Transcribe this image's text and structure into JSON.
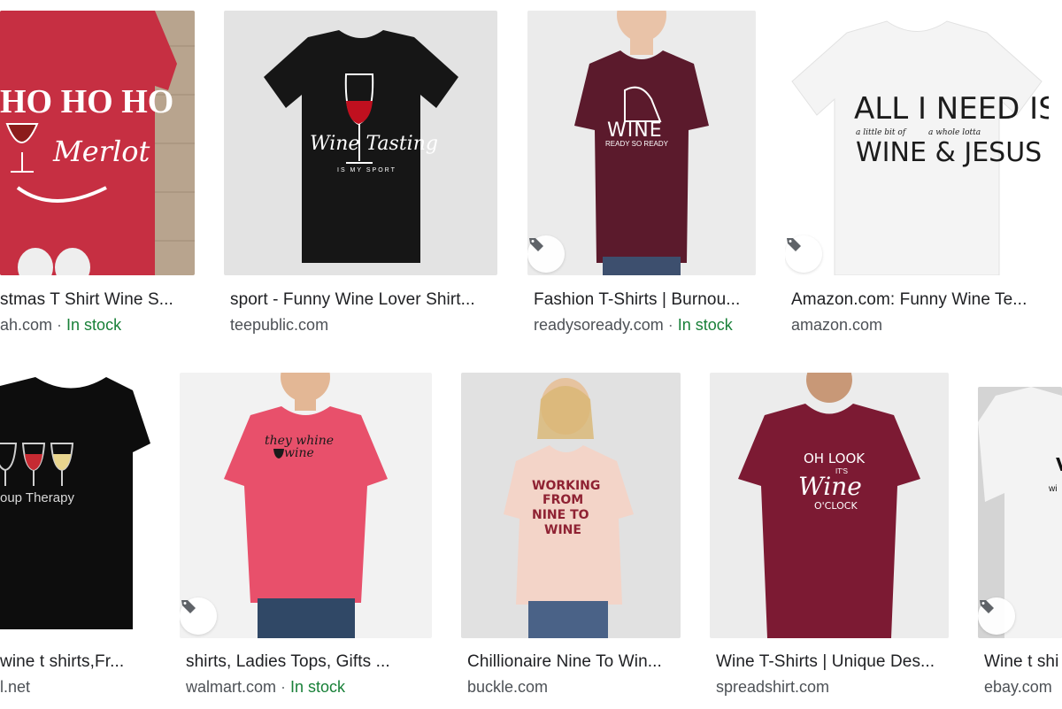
{
  "results": [
    {
      "title": "stmas T Shirt Wine S...",
      "source": "ah.com",
      "stock": "In stock",
      "shirt_color": "#c62f42",
      "bg": "#b6a28b",
      "print_line1": "HO HO HO",
      "print_line2": "Merlot"
    },
    {
      "title": "sport - Funny Wine Lover Shirt...",
      "source": "teepublic.com",
      "stock": "",
      "shirt_color": "#161616",
      "bg": "#e3e3e3",
      "print_line1": "Wine Tasting",
      "print_line2": "IS MY SPORT"
    },
    {
      "title": "Fashion T-Shirts | Burnou...",
      "source": "readysoready.com",
      "stock": "In stock",
      "shirt_color": "#5b1a2c",
      "bg": "#ebebeb",
      "print_line1": "WINE",
      "print_line2": "READY SO READY"
    },
    {
      "title": "Amazon.com: Funny Wine Te...",
      "source": "amazon.com",
      "stock": "",
      "shirt_color": "#f4f4f4",
      "bg": "#ffffff",
      "print_line1": "ALL I NEED IS",
      "print_line2": "WINE & JESUS",
      "print_small_left": "a little bit of",
      "print_small_right": "a whole lotta"
    },
    {
      "title": "wine t shirts,Fr...",
      "source": "l.net",
      "stock": "",
      "shirt_color": "#0d0d0d",
      "bg": "#ffffff",
      "print_line1": "oup Therapy",
      "print_line2": ""
    },
    {
      "title": "shirts, Ladies Tops, Gifts ...",
      "source": "walmart.com",
      "stock": "In stock",
      "shirt_color": "#e8506b",
      "bg": "#f2f2f2",
      "print_line1": "they whine",
      "print_line2": "wine"
    },
    {
      "title": "Chillionaire Nine To Win...",
      "source": "buckle.com",
      "stock": "",
      "shirt_color": "#f3d4c8",
      "bg": "#e1e1e1",
      "print_line1": "WORKING",
      "print_line2": "FROM",
      "print_line3": "NINE TO",
      "print_line4": "WINE"
    },
    {
      "title": "Wine T-Shirts | Unique Des...",
      "source": "spreadshirt.com",
      "stock": "",
      "shirt_color": "#7c1a33",
      "bg": "#ececec",
      "print_line1": "OH LOOK",
      "print_line2": "Wine",
      "print_line3": "O'CLOCK",
      "print_small": "IT'S"
    },
    {
      "title": "Wine t shi",
      "source": "ebay.com",
      "stock": "",
      "shirt_color": "#f3f3f3",
      "bg": "#d4d4d4",
      "print_line1": "wi",
      "print_line2": ""
    }
  ],
  "icons": {
    "tag": "price-tag-icon"
  },
  "colors": {
    "title": "#202124",
    "source": "#4d5156",
    "stock": "#188038"
  }
}
